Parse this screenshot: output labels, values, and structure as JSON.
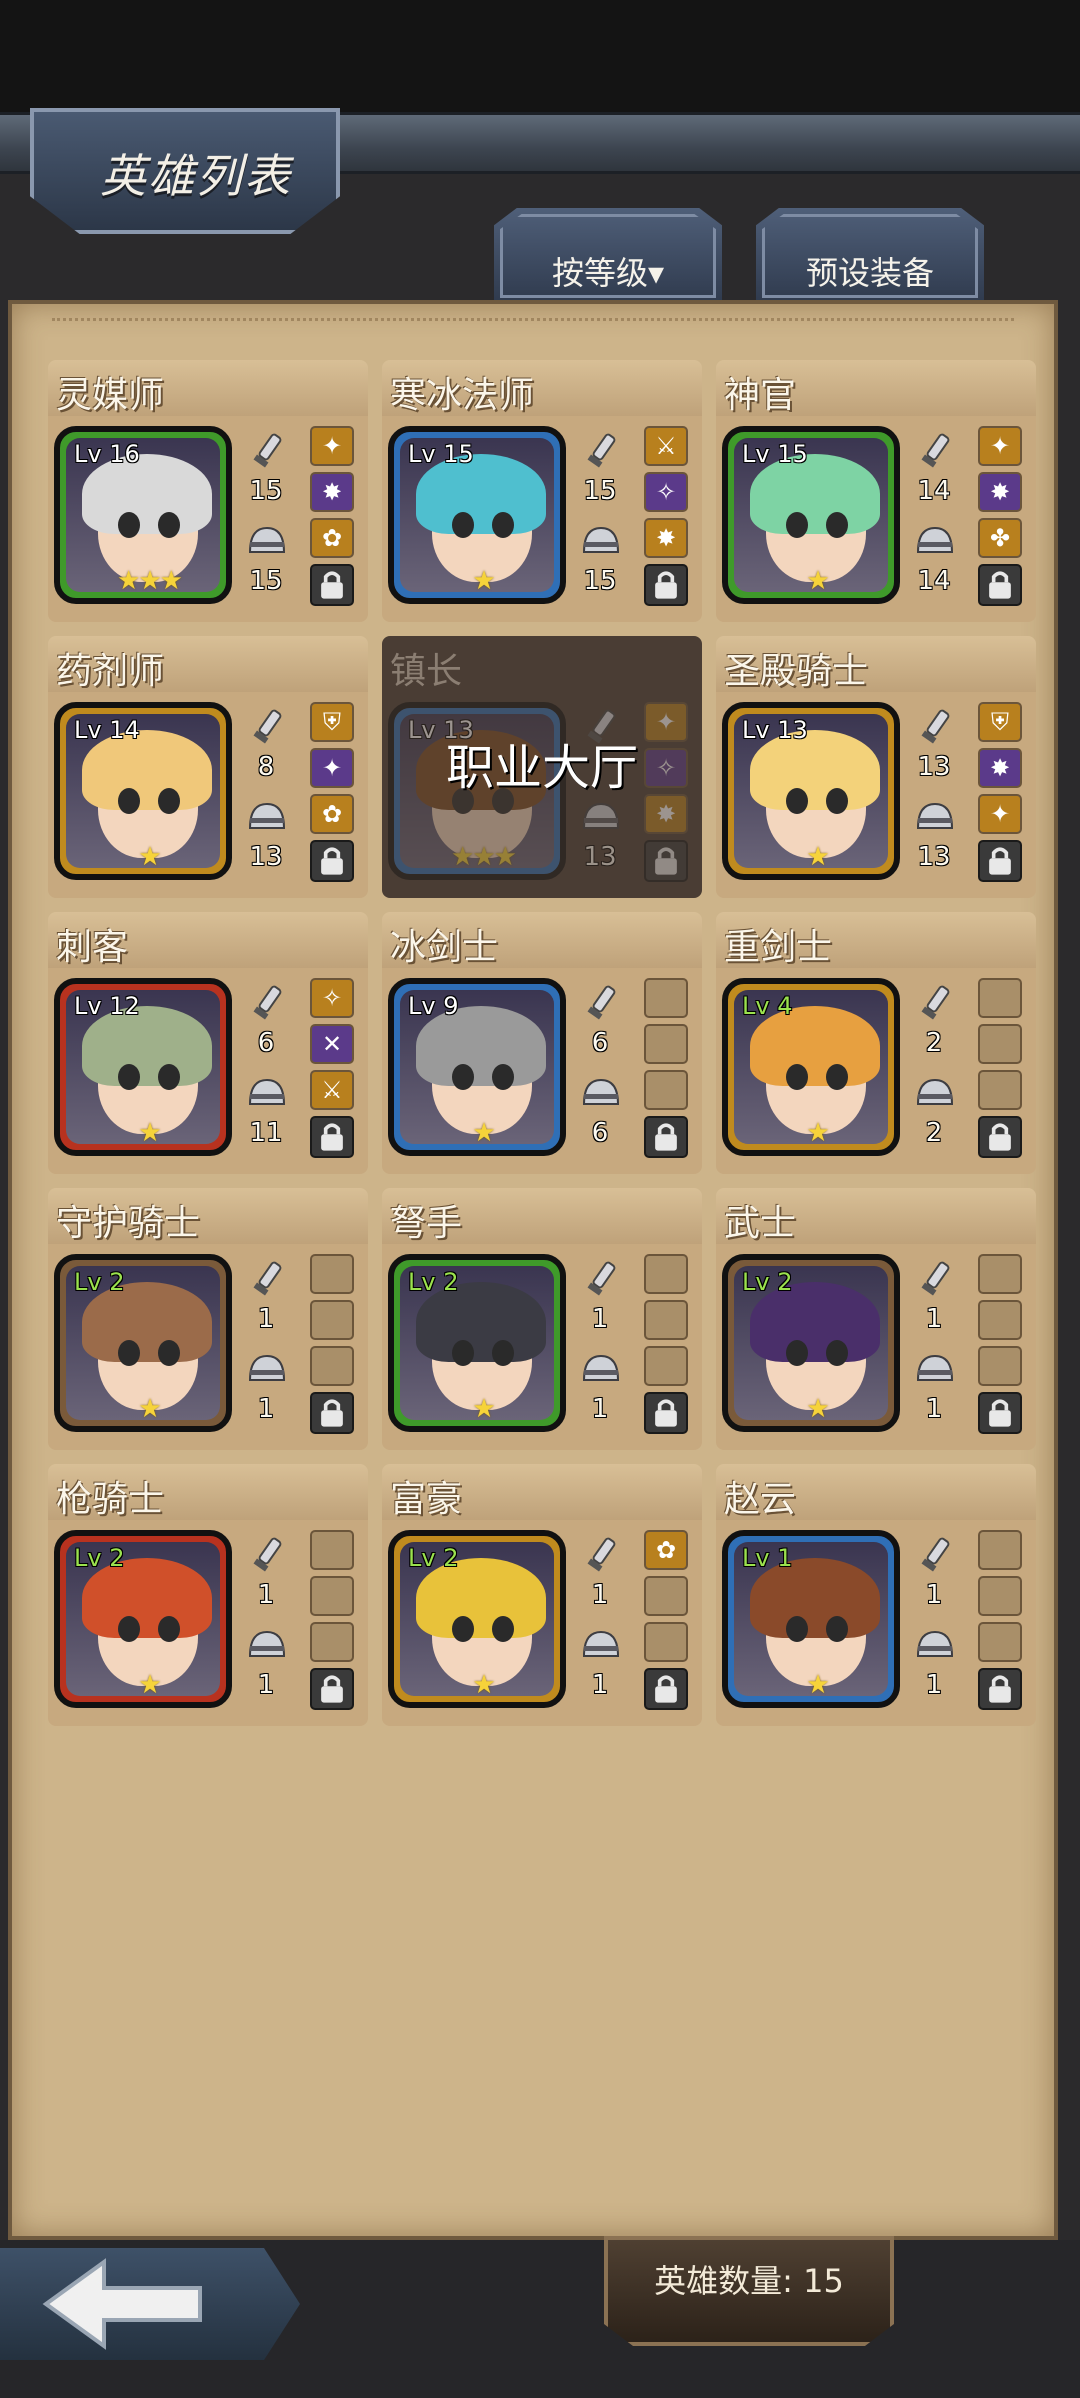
{
  "header": {
    "title": "英雄列表",
    "sort_label": "按等级▾",
    "preset_label": "预设装备"
  },
  "overlay_label": "职业大厅",
  "footer": {
    "hero_count_label": "英雄数量: 15"
  },
  "heroes": [
    {
      "name": "灵媒师",
      "level": "Lv 16",
      "stars": "★★★",
      "attack": "15",
      "defense": "15",
      "frame": "#3f9a2a",
      "hair": "#d9d9d9",
      "items": [
        "✦",
        "✸",
        "✿"
      ]
    },
    {
      "name": "寒冰法师",
      "level": "Lv 15",
      "stars": "★",
      "attack": "15",
      "defense": "15",
      "frame": "#2f6fb6",
      "hair": "#4fbfcf",
      "items": [
        "⚔",
        "✧",
        "✸"
      ]
    },
    {
      "name": "神官",
      "level": "Lv 15",
      "stars": "★",
      "attack": "14",
      "defense": "14",
      "frame": "#3f9a2a",
      "hair": "#7ed3a4",
      "items": [
        "✦",
        "✸",
        "✤"
      ]
    },
    {
      "name": "药剂师",
      "level": "Lv 14",
      "stars": "★",
      "attack": "8",
      "defense": "13",
      "frame": "#c08b1e",
      "hair": "#f0c87a",
      "items": [
        "⛨",
        "✦",
        "✿"
      ]
    },
    {
      "name": "镇长",
      "level": "Lv 13",
      "stars": "★★★",
      "attack": "",
      "defense": "13",
      "frame": "#2f6fb6",
      "hair": "#7a4a22",
      "items": [
        "✦",
        "✧",
        "✸"
      ]
    },
    {
      "name": "圣殿骑士",
      "level": "Lv 13",
      "stars": "★",
      "attack": "13",
      "defense": "13",
      "frame": "#c08b1e",
      "hair": "#f3d27a",
      "items": [
        "⛨",
        "✸",
        "✦"
      ]
    },
    {
      "name": "刺客",
      "level": "Lv 12",
      "stars": "★",
      "attack": "6",
      "defense": "11",
      "frame": "#b8321f",
      "hair": "#9fb08a",
      "items": [
        "✧",
        "✕",
        "⚔"
      ]
    },
    {
      "name": "冰剑士",
      "level": "Lv 9",
      "stars": "★",
      "attack": "6",
      "defense": "6",
      "frame": "#2f6fb6",
      "hair": "#9a9a9a",
      "items": [
        "",
        "",
        ""
      ]
    },
    {
      "name": "重剑士",
      "level": "Lv 4",
      "stars": "★",
      "attack": "2",
      "defense": "2",
      "frame": "#c08b1e",
      "hair": "#e7a040",
      "items": [
        "",
        "",
        ""
      ]
    },
    {
      "name": "守护骑士",
      "level": "Lv 2",
      "stars": "★",
      "attack": "1",
      "defense": "1",
      "frame": "#7a5a3a",
      "hair": "#9b6b4a",
      "items": [
        "",
        "",
        ""
      ]
    },
    {
      "name": "弩手",
      "level": "Lv 2",
      "stars": "★",
      "attack": "1",
      "defense": "1",
      "frame": "#3f9a2a",
      "hair": "#3b3b44",
      "items": [
        "",
        "",
        ""
      ]
    },
    {
      "name": "武士",
      "level": "Lv 2",
      "stars": "★",
      "attack": "1",
      "defense": "1",
      "frame": "#7a5a3a",
      "hair": "#4a2f6a",
      "items": [
        "",
        "",
        ""
      ]
    },
    {
      "name": "枪骑士",
      "level": "Lv 2",
      "stars": "★",
      "attack": "1",
      "defense": "1",
      "frame": "#b8321f",
      "hair": "#d0502a",
      "items": [
        "",
        "",
        ""
      ]
    },
    {
      "name": "富豪",
      "level": "Lv 2",
      "stars": "★",
      "attack": "1",
      "defense": "1",
      "frame": "#c08b1e",
      "hair": "#e8c23a",
      "items": [
        "✿",
        "",
        ""
      ]
    },
    {
      "name": "赵云",
      "level": "Lv 1",
      "stars": "★",
      "attack": "1",
      "defense": "1",
      "frame": "#2f6fb6",
      "hair": "#8a4a2a",
      "items": [
        "",
        "",
        ""
      ]
    }
  ]
}
